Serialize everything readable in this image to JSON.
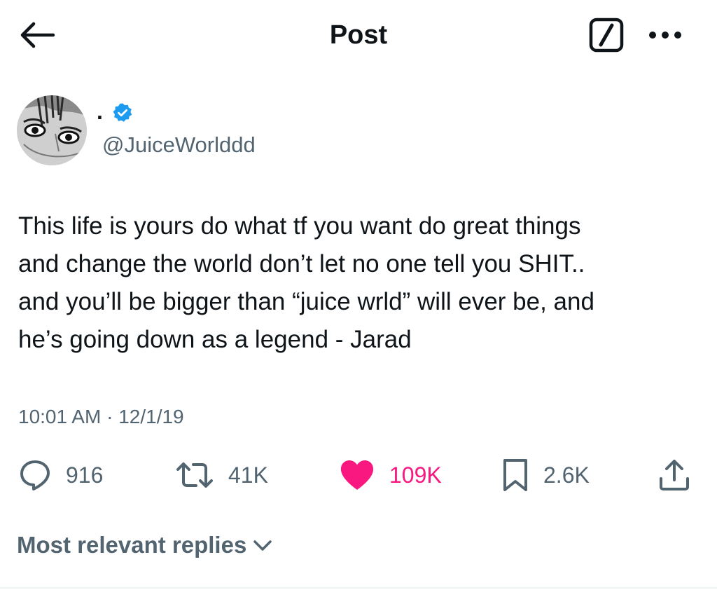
{
  "header": {
    "title": "Post"
  },
  "author": {
    "display_name": ".",
    "handle": "@JuiceWorlddd",
    "verified": true
  },
  "tweet": {
    "text": "This life is yours do what tf you want do great things\nand change the world don’t let no one tell you SHIT..\nand you’ll be bigger than “juice wrld” will ever be, and\nhe’s going down as a legend - Jarad",
    "time": "10:01 AM",
    "separator": "·",
    "date": "12/1/19"
  },
  "actions": {
    "replies": "916",
    "reposts": "41K",
    "likes": "109K",
    "bookmarks": "2.6K"
  },
  "replies_sort": {
    "label": "Most relevant replies"
  },
  "colors": {
    "text": "#0f1419",
    "secondary": "#536471",
    "like": "#f91880",
    "verified": "#1d9bf0"
  }
}
